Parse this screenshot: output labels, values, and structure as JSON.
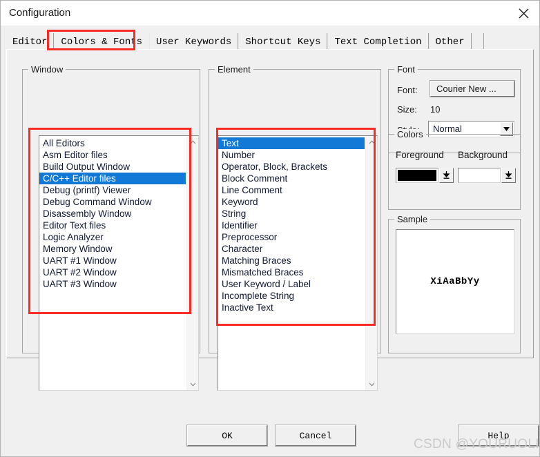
{
  "window": {
    "title": "Configuration",
    "close_icon": "close-icon"
  },
  "tabs": [
    {
      "label": "Editor",
      "active": false
    },
    {
      "label": "Colors & Fonts",
      "active": true
    },
    {
      "label": "User Keywords",
      "active": false
    },
    {
      "label": "Shortcut Keys",
      "active": false
    },
    {
      "label": "Text Completion",
      "active": false
    },
    {
      "label": "Other",
      "active": false
    }
  ],
  "window_group": {
    "caption": "Window",
    "items": [
      {
        "label": "All Editors",
        "selected": false
      },
      {
        "label": "Asm Editor files",
        "selected": false
      },
      {
        "label": "Build Output Window",
        "selected": false
      },
      {
        "label": "C/C++ Editor files",
        "selected": true
      },
      {
        "label": "Debug (printf) Viewer",
        "selected": false
      },
      {
        "label": "Debug Command Window",
        "selected": false
      },
      {
        "label": "Disassembly Window",
        "selected": false
      },
      {
        "label": "Editor Text files",
        "selected": false
      },
      {
        "label": "Logic Analyzer",
        "selected": false
      },
      {
        "label": "Memory Window",
        "selected": false
      },
      {
        "label": "UART #1 Window",
        "selected": false
      },
      {
        "label": "UART #2 Window",
        "selected": false
      },
      {
        "label": "UART #3 Window",
        "selected": false
      }
    ],
    "scroll_up_icon": "chevron-up-icon",
    "scroll_down_icon": "chevron-down-icon"
  },
  "element_group": {
    "caption": "Element",
    "items": [
      {
        "label": "Text",
        "selected": true
      },
      {
        "label": "Number",
        "selected": false
      },
      {
        "label": "Operator, Block, Brackets",
        "selected": false
      },
      {
        "label": "Block Comment",
        "selected": false
      },
      {
        "label": "Line Comment",
        "selected": false
      },
      {
        "label": "Keyword",
        "selected": false
      },
      {
        "label": "String",
        "selected": false
      },
      {
        "label": "Identifier",
        "selected": false
      },
      {
        "label": "Preprocessor",
        "selected": false
      },
      {
        "label": "Character",
        "selected": false
      },
      {
        "label": "Matching Braces",
        "selected": false
      },
      {
        "label": "Mismatched Braces",
        "selected": false
      },
      {
        "label": "User Keyword / Label",
        "selected": false
      },
      {
        "label": "Incomplete String",
        "selected": false
      },
      {
        "label": "Inactive Text",
        "selected": false
      }
    ],
    "scroll_up_icon": "chevron-up-icon",
    "scroll_down_icon": "chevron-down-icon"
  },
  "font_group": {
    "caption": "Font",
    "font_label": "Font:",
    "font_value": "Courier New ...",
    "size_label": "Size:",
    "size_value": "10",
    "style_label": "Style:",
    "style_value": "Normal",
    "style_dropdown_icon": "triangle-down-icon"
  },
  "colors_group": {
    "caption": "Colors",
    "foreground_label": "Foreground",
    "background_label": "Background",
    "foreground_color": "#000000",
    "background_color": "#ffffff",
    "dropdown_icon": "arrow-down-bar-icon"
  },
  "sample_group": {
    "caption": "Sample",
    "sample_text": "XiAaBbYy"
  },
  "buttons": {
    "ok": "OK",
    "cancel": "Cancel",
    "help": "Help"
  },
  "watermark": {
    "text": "CSDN @YOURUOLI"
  },
  "annotations": {
    "accent_color": "#fa2b25",
    "selection_color": "#1379d6"
  }
}
